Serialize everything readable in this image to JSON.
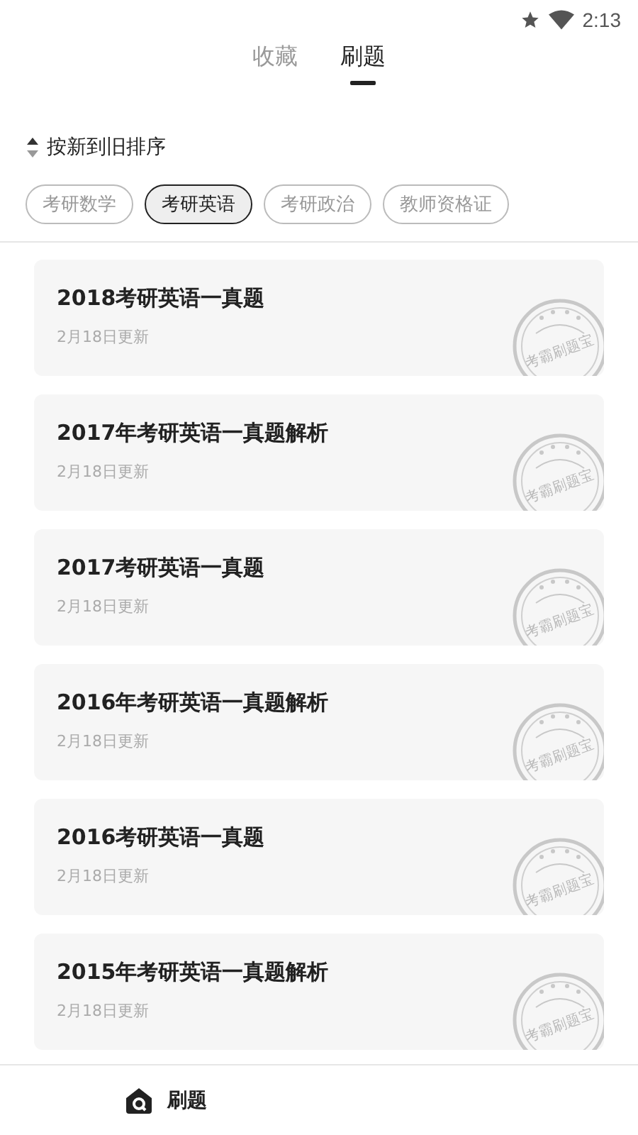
{
  "status_bar": {
    "time": "2:13"
  },
  "tabs": [
    {
      "label": "收藏",
      "selected": false
    },
    {
      "label": "刷题",
      "selected": true
    }
  ],
  "sort": {
    "label": "按新到旧排序"
  },
  "categories": [
    {
      "label": "考研数学",
      "selected": false
    },
    {
      "label": "考研英语",
      "selected": true
    },
    {
      "label": "考研政治",
      "selected": false
    },
    {
      "label": "教师资格证",
      "selected": false
    }
  ],
  "papers": [
    {
      "title": "2018考研英语一真题",
      "updated": "2月18日更新",
      "stamp": "考霸刷题宝"
    },
    {
      "title": "2017年考研英语一真题解析",
      "updated": "2月18日更新",
      "stamp": "考霸刷题宝"
    },
    {
      "title": "2017考研英语一真题",
      "updated": "2月18日更新",
      "stamp": "考霸刷题宝"
    },
    {
      "title": "2016年考研英语一真题解析",
      "updated": "2月18日更新",
      "stamp": "考霸刷题宝"
    },
    {
      "title": "2016考研英语一真题",
      "updated": "2月18日更新",
      "stamp": "考霸刷题宝"
    },
    {
      "title": "2015年考研英语一真题解析",
      "updated": "2月18日更新",
      "stamp": "考霸刷题宝"
    }
  ],
  "bottom_nav": [
    {
      "label": "刷题",
      "selected": true
    }
  ]
}
